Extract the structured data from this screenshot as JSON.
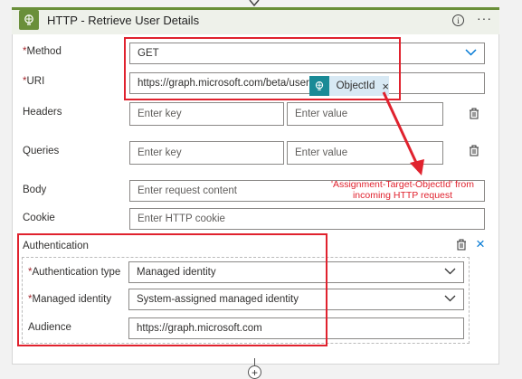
{
  "header": {
    "title": "HTTP - Retrieve User Details",
    "info_glyph": "i",
    "more_glyph": "···"
  },
  "method": {
    "label": "Method",
    "required_mark": "*",
    "value": "GET"
  },
  "uri": {
    "label": "URI",
    "required_mark": "*",
    "value": "https://graph.microsoft.com/beta/users/",
    "token_label": "ObjectId",
    "token_remove": "×"
  },
  "headers": {
    "label": "Headers",
    "key_placeholder": "Enter key",
    "value_placeholder": "Enter value"
  },
  "queries": {
    "label": "Queries",
    "key_placeholder": "Enter key",
    "value_placeholder": "Enter value"
  },
  "body": {
    "label": "Body",
    "placeholder": "Enter request content"
  },
  "cookie": {
    "label": "Cookie",
    "placeholder": "Enter HTTP cookie"
  },
  "authentication": {
    "label": "Authentication",
    "close_glyph": "×",
    "type": {
      "label": "Authentication type",
      "required_mark": "*",
      "value": "Managed identity"
    },
    "identity": {
      "label": "Managed identity",
      "required_mark": "*",
      "value": "System-assigned managed identity"
    },
    "audience": {
      "label": "Audience",
      "value": "https://graph.microsoft.com"
    }
  },
  "annotation": {
    "line1": "'Assignment-Target-ObjectId' from",
    "line2": "incoming HTTP request"
  },
  "footer": {
    "plus_glyph": "+"
  },
  "colors": {
    "accent": "#6a8f3a",
    "highlight": "#e0222e",
    "token_bg": "#d8e9f4",
    "token_icon": "#1a8a96",
    "link_blue": "#0078d4"
  }
}
